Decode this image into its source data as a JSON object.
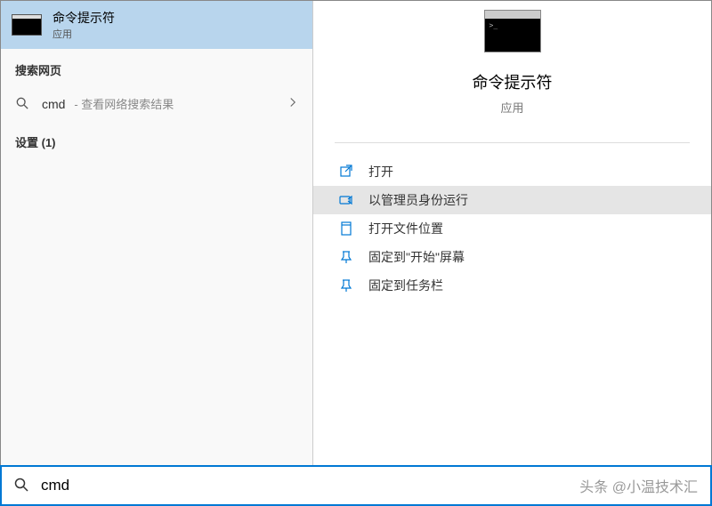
{
  "left": {
    "bestMatch": {
      "title": "命令提示符",
      "subtitle": "应用"
    },
    "webHeader": "搜索网页",
    "webResult": {
      "query": "cmd",
      "subtext": "- 查看网络搜索结果"
    },
    "settingsHeader": "设置 (1)"
  },
  "detail": {
    "title": "命令提示符",
    "subtitle": "应用",
    "actions": [
      {
        "label": "打开",
        "icon": "open"
      },
      {
        "label": "以管理员身份运行",
        "icon": "admin",
        "highlighted": true
      },
      {
        "label": "打开文件位置",
        "icon": "folder"
      },
      {
        "label": "固定到\"开始\"屏幕",
        "icon": "pin-start"
      },
      {
        "label": "固定到任务栏",
        "icon": "pin-taskbar"
      }
    ]
  },
  "searchBar": {
    "value": "cmd",
    "watermark": "头条 @小温技术汇"
  }
}
